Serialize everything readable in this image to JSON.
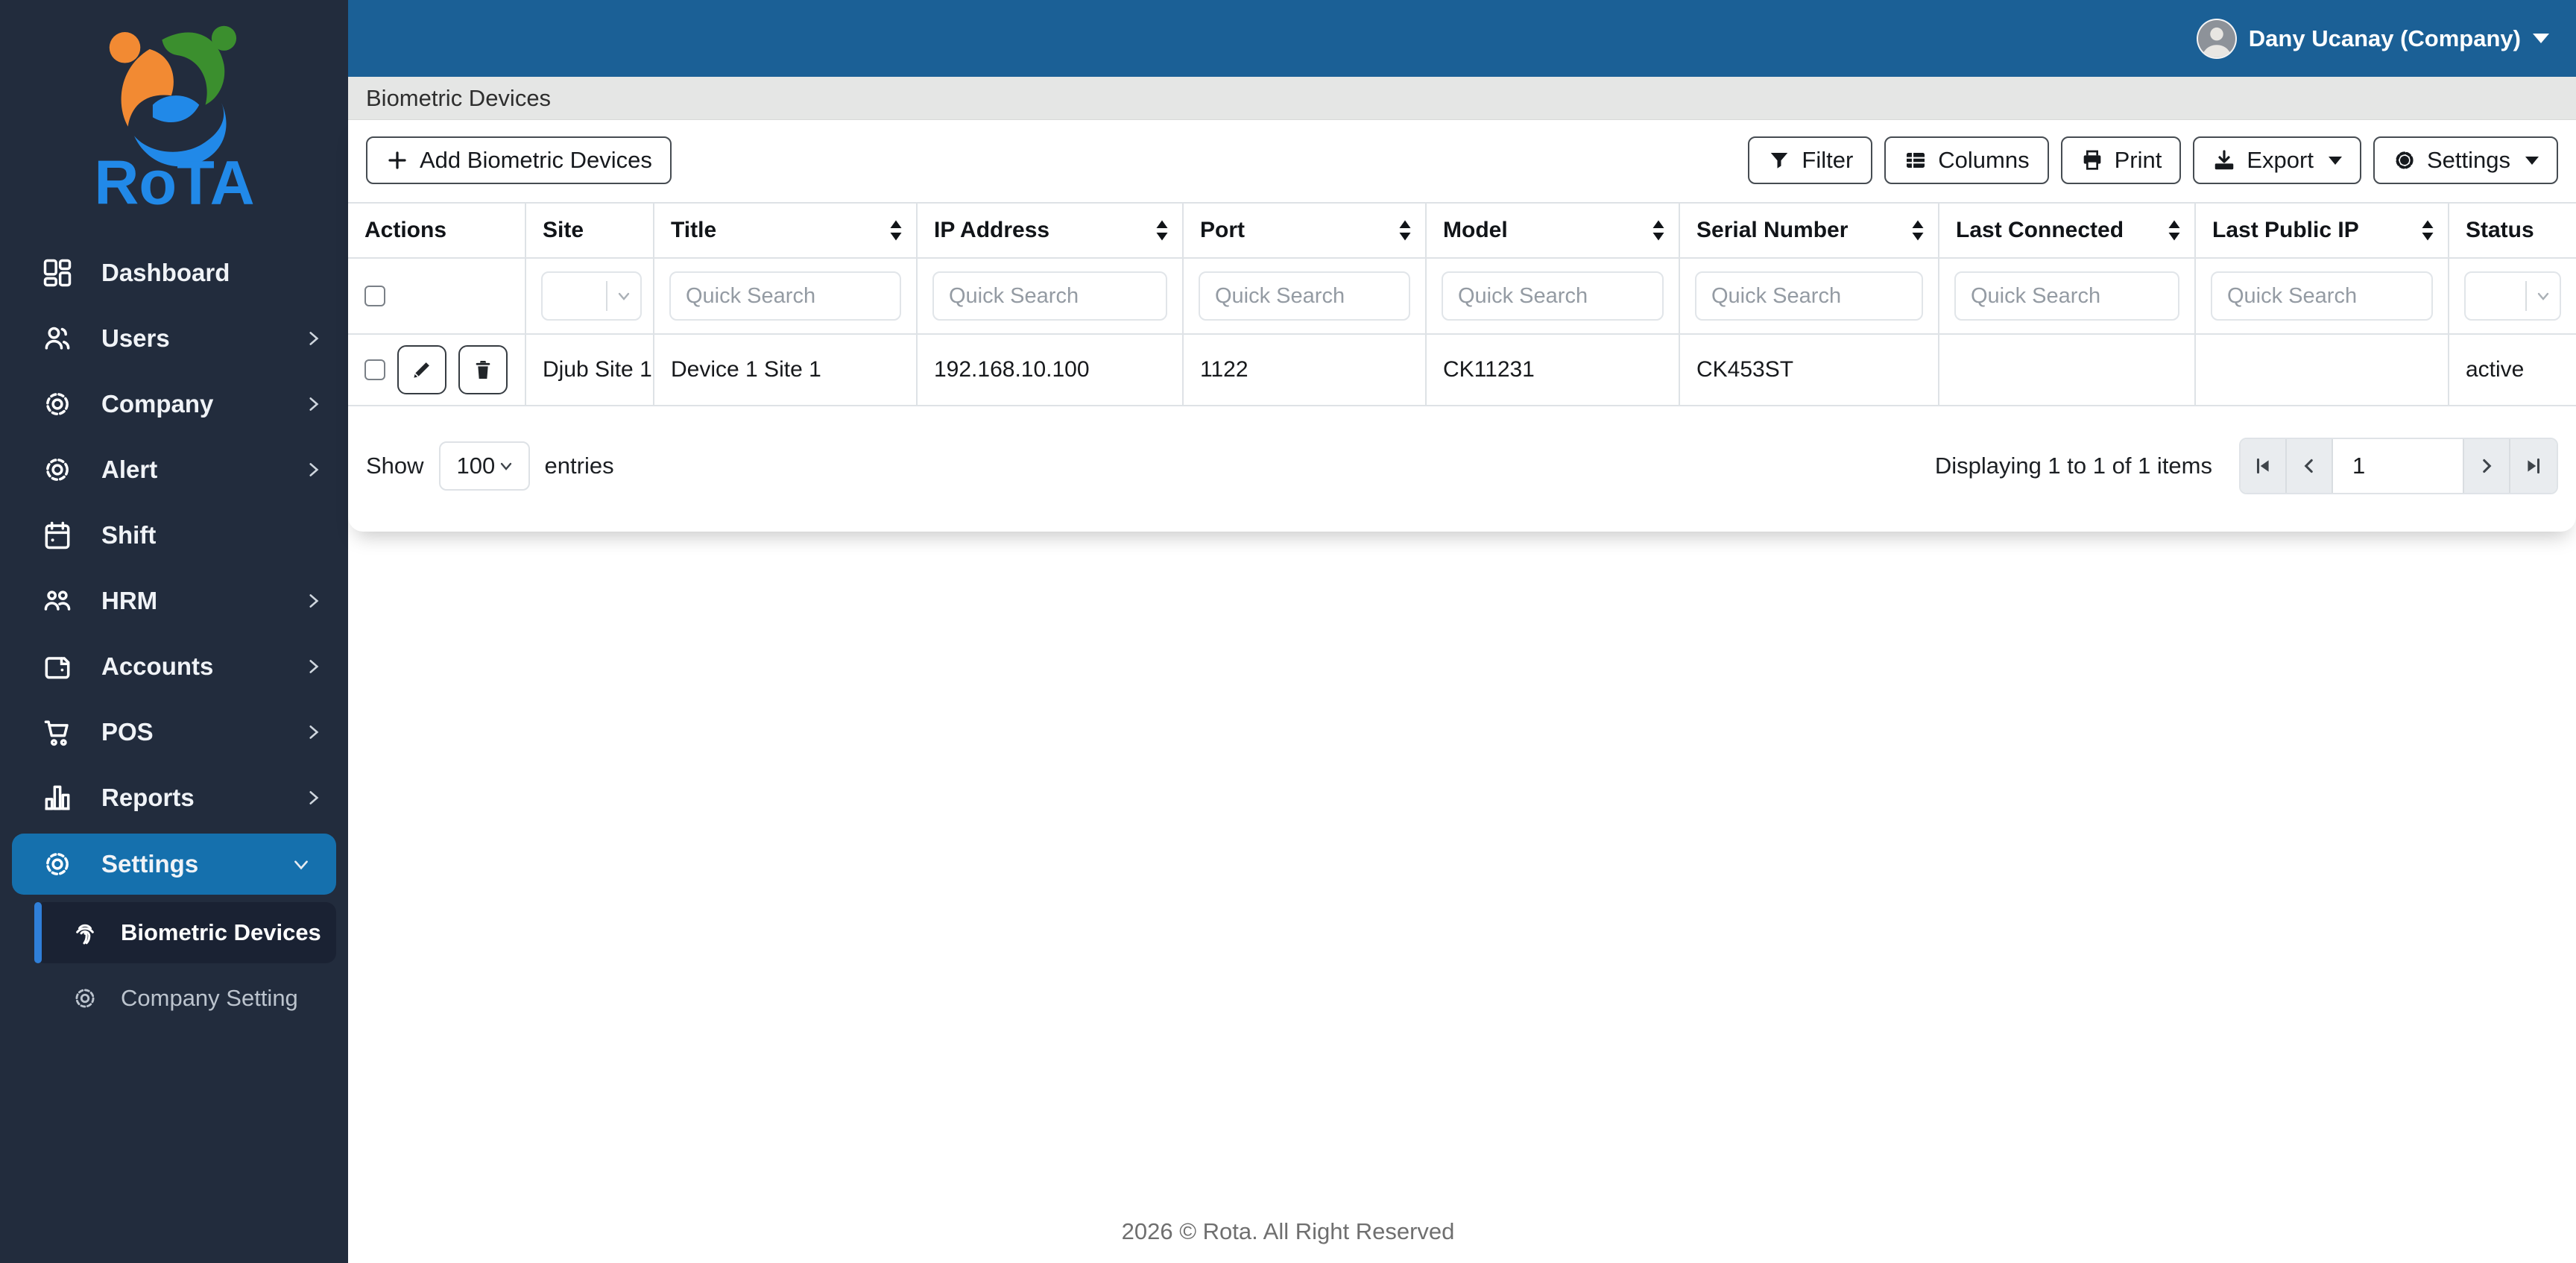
{
  "logo": {
    "text": "RoTA"
  },
  "colors": {
    "sidebar_bg": "#222c3d",
    "topbar_blue": "#1b6096",
    "active_item_blue": "#1570ad",
    "submenu_active_bg": "#1a2233",
    "submenu_accent": "#2f7fd9",
    "breadcrumb_bg": "#e5e6e5",
    "table_border": "#dee2e6",
    "logo_orange": "#f28a33",
    "logo_green": "#3b8f2e",
    "logo_blue": "#2189e8"
  },
  "topbar": {
    "user": "Dany Ucanay (Company)"
  },
  "sidebar": {
    "items": [
      {
        "label": "Dashboard",
        "icon": "dashboard-icon",
        "chevron": "none"
      },
      {
        "label": "Users",
        "icon": "users-icon",
        "chevron": "right"
      },
      {
        "label": "Company",
        "icon": "gear-icon",
        "chevron": "right"
      },
      {
        "label": "Alert",
        "icon": "gear-icon",
        "chevron": "right"
      },
      {
        "label": "Shift",
        "icon": "calendar-icon",
        "chevron": "none"
      },
      {
        "label": "HRM",
        "icon": "people-group-icon",
        "chevron": "right"
      },
      {
        "label": "Accounts",
        "icon": "wallet-icon",
        "chevron": "right"
      },
      {
        "label": "POS",
        "icon": "cart-icon",
        "chevron": "right"
      },
      {
        "label": "Reports",
        "icon": "bar-chart-icon",
        "chevron": "right"
      },
      {
        "label": "Settings",
        "icon": "gear-icon",
        "chevron": "down",
        "active": true
      }
    ],
    "submenu": [
      {
        "label": "Biometric Devices",
        "icon": "fingerprint-icon",
        "active": true
      },
      {
        "label": "Company Setting",
        "icon": "gear-icon",
        "active": false
      }
    ]
  },
  "breadcrumb": {
    "title": "Biometric Devices"
  },
  "toolbar": {
    "add_label": "Add Biometric Devices",
    "filter_label": "Filter",
    "columns_label": "Columns",
    "print_label": "Print",
    "export_label": "Export",
    "settings_label": "Settings"
  },
  "table": {
    "search_placeholder": "Quick Search",
    "columns": [
      {
        "label": "Actions",
        "sortable": false
      },
      {
        "label": "Site",
        "sortable": false
      },
      {
        "label": "Title",
        "sortable": true
      },
      {
        "label": "IP Address",
        "sortable": true
      },
      {
        "label": "Port",
        "sortable": true
      },
      {
        "label": "Model",
        "sortable": true
      },
      {
        "label": "Serial Number",
        "sortable": true
      },
      {
        "label": "Last Connected",
        "sortable": true
      },
      {
        "label": "Last Public IP",
        "sortable": true
      },
      {
        "label": "Status",
        "sortable": false
      }
    ],
    "rows": [
      {
        "site": "Djub Site 1",
        "title": "Device 1 Site 1",
        "ip": "192.168.10.100",
        "port": "1122",
        "model": "CK11231",
        "serial": "CK453ST",
        "last_connected": "",
        "last_public_ip": "",
        "status": "active"
      }
    ]
  },
  "pagination": {
    "show_label": "Show",
    "page_size": "100",
    "entries_label": "entries",
    "summary": "Displaying 1 to 1 of 1 items",
    "current_page": "1"
  },
  "footer": {
    "text": "2026 © Rota. All Right Reserved"
  },
  "icons": {
    "plus-icon": "plus sign",
    "filter-icon": "funnel",
    "columns-icon": "table grid",
    "print-icon": "printer",
    "export-icon": "download arrow into tray",
    "gear-icon": "cog",
    "caret-down-icon": "solid down triangle",
    "sort-icon": "up/down triangles",
    "edit-icon": "pencil",
    "delete-icon": "trash can",
    "chevron-right-icon": "thin right chevron",
    "chevron-down-icon": "thin down chevron",
    "first-page-icon": "bar + left triangle",
    "prev-page-icon": "left chevron",
    "next-page-icon": "right chevron",
    "last-page-icon": "right triangle + bar",
    "avatar": "user profile photo"
  }
}
